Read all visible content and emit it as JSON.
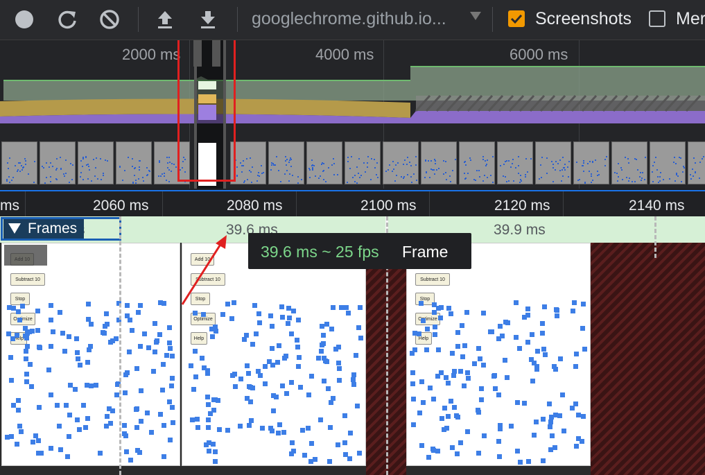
{
  "toolbar": {
    "record_icon": "record-circle-icon",
    "reload_icon": "reload-icon",
    "clear_icon": "clear-block-icon",
    "upload_icon": "upload-arrow-icon",
    "download_icon": "download-arrow-icon",
    "url": "googlechrome.github.io...",
    "screenshots_label": "Screenshots",
    "screenshots_checked": true,
    "memory_label": "Mer",
    "memory_checked": false,
    "accent": "#f29900"
  },
  "overview": {
    "ticks": [
      "2000 ms",
      "4000 ms",
      "6000 ms"
    ]
  },
  "ruler": {
    "labels": [
      "ms",
      "2060 ms",
      "2080 ms",
      "2100 ms",
      "2120 ms",
      "2140 ms"
    ]
  },
  "frames": {
    "track_label": "Frames",
    "label_partial": "s",
    "durations": [
      "39.6 ms",
      "39.9 ms"
    ],
    "screenshot_buttons": [
      "Add 10",
      "Subtract 10",
      "Stop",
      "Optimize",
      "Help"
    ]
  },
  "tooltip": {
    "timing": "39.6 ms ~ 25 fps",
    "label": "Frame"
  },
  "colors": {
    "selection_box": "#e02020",
    "frames_track_bg": "#d6f0d6",
    "dot_blue": "#3d7ee6"
  }
}
